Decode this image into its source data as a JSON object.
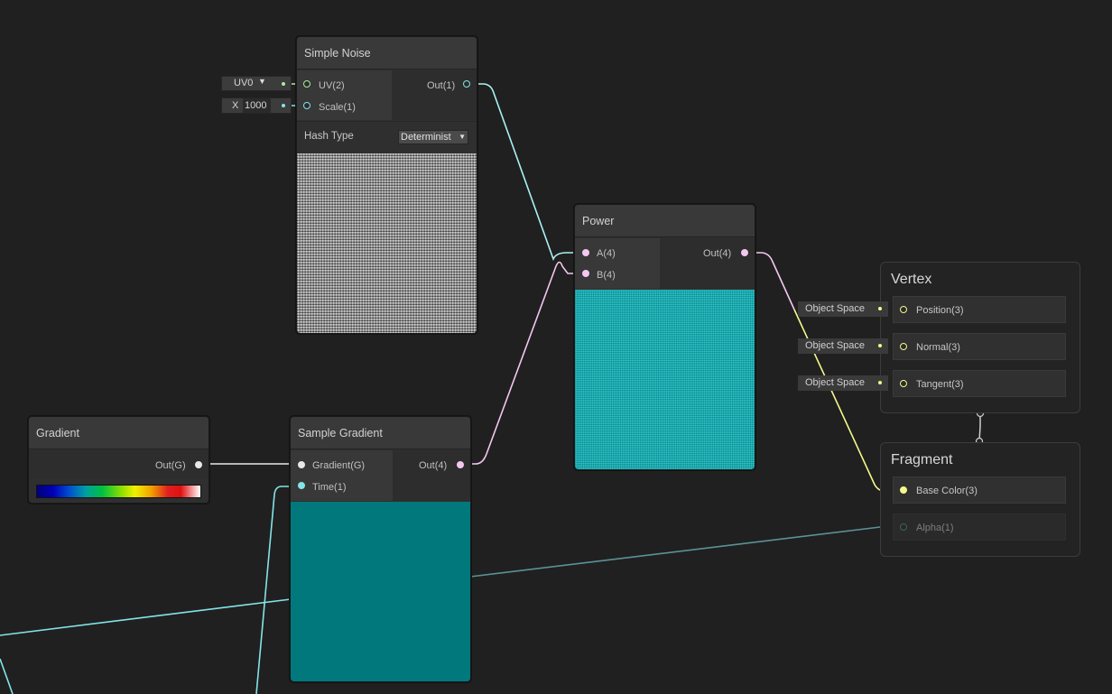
{
  "colors": {
    "wire_vector": "#a9f2f3",
    "wire_vector4": "#f4c7f1",
    "wire_vector3": "#f6f88d",
    "wire_float": "#84e4e7",
    "wire_float_dim": "#5a9396",
    "preview_solid": "#00787c"
  },
  "simple_noise": {
    "title": "Simple Noise",
    "in_uv": "UV(2)",
    "in_scale": "Scale(1)",
    "out": "Out(1)",
    "hash_label": "Hash Type",
    "hash_value": "Determinist",
    "uv_field": "UV0",
    "scale_axis": "X",
    "scale_value": "1000"
  },
  "power": {
    "title": "Power",
    "in_a": "A(4)",
    "in_b": "B(4)",
    "out": "Out(4)"
  },
  "gradient": {
    "title": "Gradient",
    "out": "Out(G)"
  },
  "sample_gradient": {
    "title": "Sample Gradient",
    "in_gradient": "Gradient(G)",
    "in_time": "Time(1)",
    "out": "Out(4)"
  },
  "vertex": {
    "title": "Vertex",
    "slots": [
      "Position(3)",
      "Normal(3)",
      "Tangent(3)"
    ],
    "space_fields": [
      "Object Space",
      "Object Space",
      "Object Space"
    ]
  },
  "fragment": {
    "title": "Fragment",
    "slots": [
      "Base Color(3)",
      "Alpha(1)"
    ]
  }
}
